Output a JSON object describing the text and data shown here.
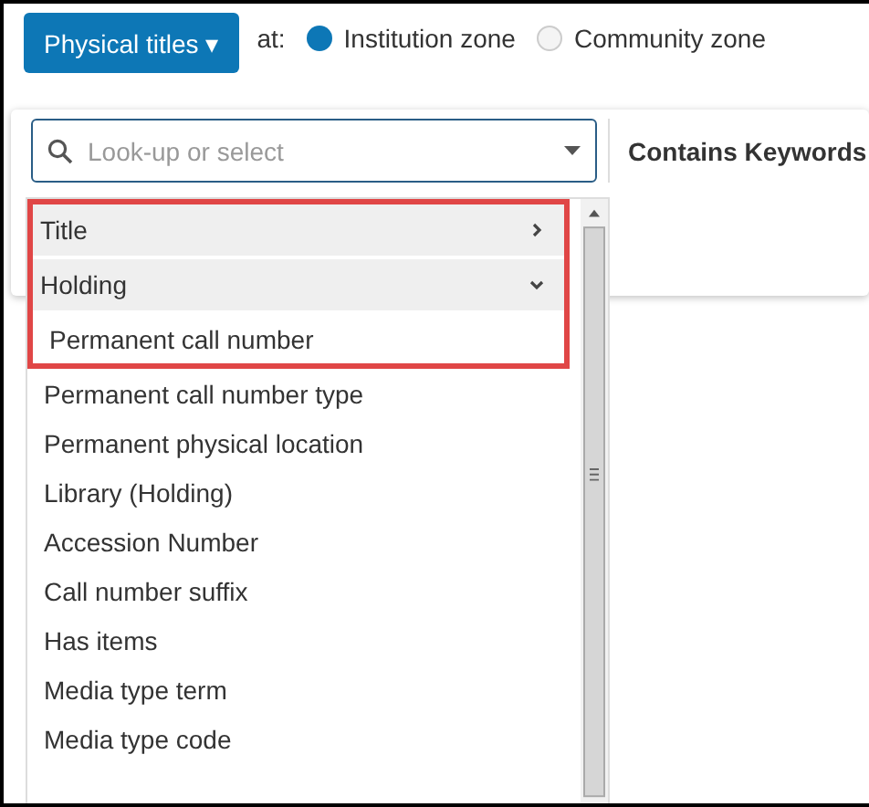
{
  "type_button": {
    "label": "Physical titles ▾"
  },
  "zone": {
    "label": "at:",
    "options": [
      {
        "label": "Institution zone",
        "selected": true
      },
      {
        "label": "Community zone",
        "selected": false
      }
    ]
  },
  "search": {
    "placeholder": "Look-up or select"
  },
  "column_header": "Contains Keywords",
  "field_list": [
    {
      "label": "Title",
      "expanded": false,
      "highlighted": true
    },
    {
      "label": "Holding",
      "expanded": true,
      "highlighted": true,
      "children": [
        {
          "label": "Permanent call number",
          "highlighted": true
        },
        {
          "label": "Permanent call number type",
          "highlighted": false
        },
        {
          "label": "Permanent physical location",
          "highlighted": false
        },
        {
          "label": "Library (Holding)",
          "highlighted": false
        },
        {
          "label": "Accession Number",
          "highlighted": false
        },
        {
          "label": "Call number suffix",
          "highlighted": false
        },
        {
          "label": "Has items",
          "highlighted": false
        },
        {
          "label": "Media type term",
          "highlighted": false
        },
        {
          "label": "Media type code",
          "highlighted": false
        }
      ]
    }
  ]
}
